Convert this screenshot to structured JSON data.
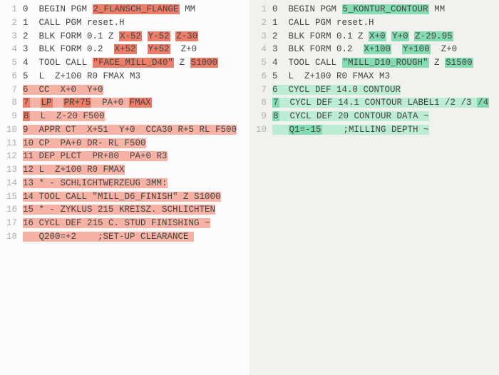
{
  "left": {
    "lines": [
      {
        "n": 1,
        "seg": [
          [
            "0  BEGIN PGM ",
            ""
          ],
          [
            "2_FLANSCH_FLANGE",
            "w"
          ],
          [
            " MM",
            ""
          ]
        ]
      },
      {
        "n": 2,
        "seg": [
          [
            "1  CALL PGM reset.H",
            ""
          ]
        ]
      },
      {
        "n": 3,
        "seg": [
          [
            "2  BLK FORM 0.1 Z ",
            ""
          ],
          [
            "X-52",
            "w"
          ],
          [
            " ",
            ""
          ],
          [
            "Y-52",
            "w"
          ],
          [
            " ",
            ""
          ],
          [
            "Z-30",
            "w"
          ]
        ]
      },
      {
        "n": 4,
        "seg": [
          [
            "3  BLK FORM 0.2  ",
            ""
          ],
          [
            "X+52",
            "w"
          ],
          [
            "  ",
            ""
          ],
          [
            "Y+52",
            "w"
          ],
          [
            "  Z+0",
            ""
          ]
        ]
      },
      {
        "n": 5,
        "seg": [
          [
            "4  TOOL CALL ",
            ""
          ],
          [
            "\"FACE_MILL_D40\"",
            "w"
          ],
          [
            " Z ",
            ""
          ],
          [
            "S1000",
            "w"
          ]
        ]
      },
      {
        "n": 6,
        "seg": [
          [
            "5  L  Z+100 R0 FMAX M3",
            ""
          ]
        ]
      },
      {
        "n": 7,
        "seg": [
          [
            "6  CC  X+0  Y+0",
            "l"
          ]
        ]
      },
      {
        "n": 8,
        "seg": [
          [
            "7",
            "w"
          ],
          [
            "  ",
            "l"
          ],
          [
            "LP",
            "w"
          ],
          [
            "  ",
            "l"
          ],
          [
            "PR+75",
            "w"
          ],
          [
            "  PA+0 ",
            "l"
          ],
          [
            "FMAX",
            "w"
          ]
        ]
      },
      {
        "n": 9,
        "seg": [
          [
            "8",
            "w"
          ],
          [
            "  L  Z-20 F500",
            "l"
          ]
        ]
      },
      {
        "n": 10,
        "seg": [
          [
            "9  APPR CT  X+51  Y+0  CCA30 R+5 RL F500",
            "l"
          ]
        ]
      },
      {
        "n": 11,
        "seg": [
          [
            "10 CP  PA+0 DR- RL F500",
            "l"
          ]
        ]
      },
      {
        "n": 12,
        "seg": [
          [
            "11 DEP PLCT  PR+80  PA+0 R3",
            "l"
          ]
        ]
      },
      {
        "n": 13,
        "seg": [
          [
            "12 L  Z+100 R0 FMAX",
            "l"
          ]
        ]
      },
      {
        "n": 14,
        "seg": [
          [
            "13 * - SCHLICHTWERZEUG 3MM:",
            "l"
          ]
        ]
      },
      {
        "n": 15,
        "seg": [
          [
            "14 TOOL CALL \"MILL_D6_FINISH\" Z S1000",
            "l"
          ]
        ]
      },
      {
        "n": 16,
        "seg": [
          [
            "15 * - ZYKLUS 215 KREISZ. SCHLICHTEN",
            "l"
          ]
        ]
      },
      {
        "n": 17,
        "seg": [
          [
            "16 CYCL DEF 215 C. STUD FINISHING ~",
            "l"
          ]
        ]
      },
      {
        "n": 18,
        "seg": [
          [
            "   Q200=+2    ;SET-UP CLEARANCE ",
            "l"
          ]
        ]
      }
    ]
  },
  "right": {
    "lines": [
      {
        "n": 1,
        "seg": [
          [
            "0  BEGIN PGM ",
            ""
          ],
          [
            "5_KONTUR_CONTOUR",
            "w"
          ],
          [
            " MM",
            ""
          ]
        ]
      },
      {
        "n": 2,
        "seg": [
          [
            "1  CALL PGM reset.H",
            ""
          ]
        ]
      },
      {
        "n": 3,
        "seg": [
          [
            "2  BLK FORM 0.1 Z ",
            ""
          ],
          [
            "X+0",
            "w"
          ],
          [
            " ",
            ""
          ],
          [
            "Y+0",
            "w"
          ],
          [
            " ",
            ""
          ],
          [
            "Z-29.95",
            "w"
          ]
        ]
      },
      {
        "n": 4,
        "seg": [
          [
            "3  BLK FORM 0.2  ",
            ""
          ],
          [
            "X+100",
            "w"
          ],
          [
            "  ",
            ""
          ],
          [
            "Y+100",
            "w"
          ],
          [
            "  Z+0",
            ""
          ]
        ]
      },
      {
        "n": 5,
        "seg": [
          [
            "4  TOOL CALL ",
            ""
          ],
          [
            "\"MILL_D10_ROUGH\"",
            "w"
          ],
          [
            " Z ",
            ""
          ],
          [
            "S1500",
            "w"
          ]
        ]
      },
      {
        "n": 6,
        "seg": [
          [
            "5  L  Z+100 R0 FMAX M3",
            ""
          ]
        ]
      },
      {
        "n": 7,
        "seg": [
          [
            "6  CYCL DEF 14.0 CONTOUR",
            "l"
          ]
        ]
      },
      {
        "n": 8,
        "seg": [
          [
            "7",
            "w"
          ],
          [
            "  CYCL DEF 14.1 CONTOUR LABEL1 /2 /3 ",
            "l"
          ],
          [
            "/4",
            "w"
          ]
        ]
      },
      {
        "n": 9,
        "seg": [
          [
            "8",
            "w"
          ],
          [
            "  CYCL DEF 20 CONTOUR DATA ~",
            "l"
          ]
        ]
      },
      {
        "n": 10,
        "seg": [
          [
            "   ",
            "l"
          ],
          [
            "Q1=-15",
            "w"
          ],
          [
            "    ;MILLING DEPTH ~",
            "l"
          ]
        ]
      }
    ]
  }
}
